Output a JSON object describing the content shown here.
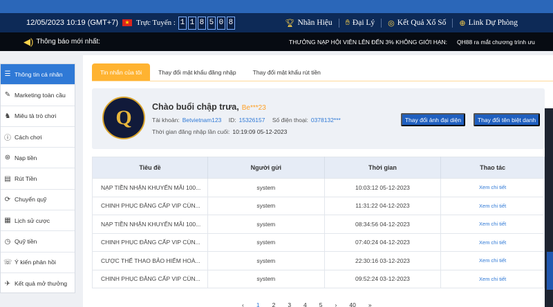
{
  "header": {
    "datetime": "12/05/2023 10:19 (GMT+7)",
    "online_label": "Trực Tuyến :",
    "online_count_digits": [
      "1",
      "1",
      "8",
      "5",
      "0",
      "8"
    ],
    "links": [
      {
        "icon": "trophy-icon",
        "label": "Nhãn Hiệu"
      },
      {
        "icon": "handshake-icon",
        "label": "Đại Lý"
      },
      {
        "icon": "lottery-ball-icon",
        "label": "Kết Quả Xổ Số"
      },
      {
        "icon": "globe-icon",
        "label": "Link Dự Phòng"
      }
    ]
  },
  "notice": {
    "label": "Thông báo mới nhất:",
    "messages": [
      "THƯỞNG NẠP HỘI VIÊN LÊN ĐẾN 3% KHÔNG GIỚI HẠN:",
      "QH88 ra mắt chương trình ưu"
    ]
  },
  "sidebar": {
    "items": [
      {
        "icon": "list-icon",
        "label": "Thông tin cá nhân",
        "active": true
      },
      {
        "icon": "megaphone-icon",
        "label": "Marketing toàn cầu"
      },
      {
        "icon": "gamepad-icon",
        "label": "Miêu tả trò chơi"
      },
      {
        "icon": "info-icon",
        "label": "Cách chơi"
      },
      {
        "icon": "deposit-icon",
        "label": "Nạp tiền"
      },
      {
        "icon": "withdraw-icon",
        "label": "Rút Tiền"
      },
      {
        "icon": "transfer-icon",
        "label": "Chuyển quỹ"
      },
      {
        "icon": "history-icon",
        "label": "Lịch sử cược"
      },
      {
        "icon": "fund-icon",
        "label": "Quỹ tiền"
      },
      {
        "icon": "feedback-icon",
        "label": "Ý kiến phản hồi"
      },
      {
        "icon": "results-icon",
        "label": "Kết quả mở thưởng"
      }
    ]
  },
  "tabs": [
    {
      "label": "Tin nhắn của tôi",
      "active": true
    },
    {
      "label": "Thay đổi mật khẩu đăng nhập"
    },
    {
      "label": "Thay đổi mật khẩu rút tiền"
    }
  ],
  "profile": {
    "greeting": "Chào buổi chập trưa,",
    "username": "Be***23",
    "account_label": "Tài khoản:",
    "account_value": "Betvietnam123",
    "id_label": "ID:",
    "id_value": "15326157",
    "phone_label": "Số điện thoại:",
    "phone_value": "0378132***",
    "last_login_label": "Thời gian đăng nhập lần cuối:",
    "last_login_value": "10:19:09 05-12-2023",
    "btn_change_avatar": "Thay đổi ảnh đại diện",
    "btn_change_nickname": "Thay đổi tên biệt danh"
  },
  "table": {
    "headers": [
      "Tiêu đề",
      "Người gửi",
      "Thời gian",
      "Thao tác"
    ],
    "rows": [
      {
        "title": "NẠP TIỀN NHẬN KHUYẾN MÃI 100...",
        "sender": "system",
        "time": "10:03:12 05-12-2023",
        "action": "Xem chi tiết"
      },
      {
        "title": "CHINH PHỤC ĐẲNG CẤP VIP CÙN...",
        "sender": "system",
        "time": "11:31:22 04-12-2023",
        "action": "Xem chi tiết"
      },
      {
        "title": "NẠP TIỀN NHẬN KHUYẾN MÃI 100...",
        "sender": "system",
        "time": "08:34:56 04-12-2023",
        "action": "Xem chi tiết"
      },
      {
        "title": "CHINH PHỤC ĐẲNG CẤP VIP CÙN...",
        "sender": "system",
        "time": "07:40:24 04-12-2023",
        "action": "Xem chi tiết"
      },
      {
        "title": "CƯỢC THỂ THAO BẢO HIỂM HOÀ...",
        "sender": "system",
        "time": "22:30:16 03-12-2023",
        "action": "Xem chi tiết"
      },
      {
        "title": "CHINH PHỤC ĐẲNG CẤP VIP CÙN...",
        "sender": "system",
        "time": "09:52:24 03-12-2023",
        "action": "Xem chi tiết"
      }
    ]
  },
  "pagination": [
    "‹",
    "1",
    "2",
    "3",
    "4",
    "5",
    "›",
    "40",
    "»"
  ],
  "colors": {
    "header_bg": "#0d2a57",
    "accent_blue": "#2f79d6",
    "tab_orange": "#ffb331",
    "username_orange": "#ffa024"
  }
}
